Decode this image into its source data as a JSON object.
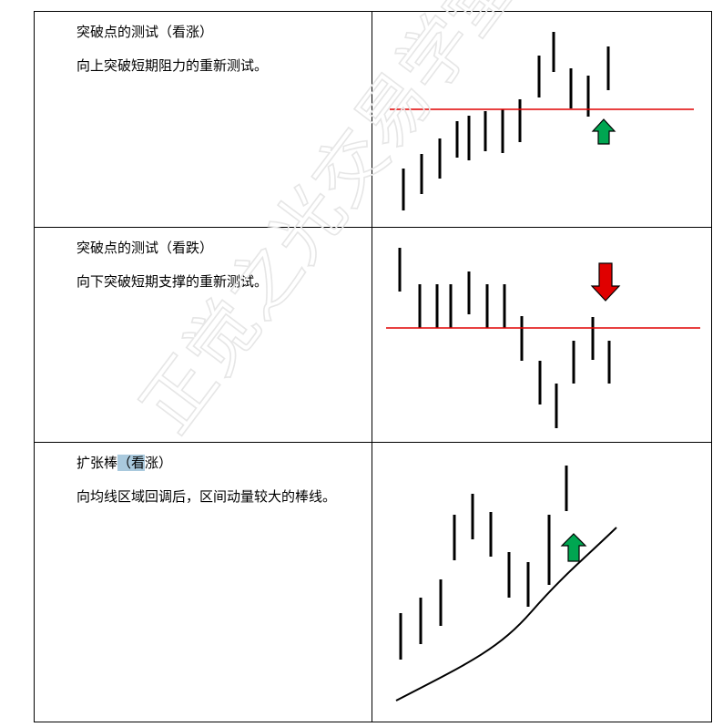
{
  "rows": [
    {
      "title": "突破点的测试（看涨）",
      "description": "向上突破短期阻力的重新测试。",
      "signal": "up",
      "colors": {
        "level_line": "#e00000",
        "arrow": "#00a651"
      }
    },
    {
      "title": "突破点的测试（看跌）",
      "description": "向下突破短期支撑的重新测试。",
      "signal": "down",
      "colors": {
        "level_line": "#e00000",
        "arrow": "#e00000"
      }
    },
    {
      "title_prefix": "扩张棒",
      "title_highlight": "（看",
      "title_suffix": "涨）",
      "description": "向均线区域回调后，区间动量较大的棒线。",
      "signal": "up",
      "colors": {
        "moving_average": "#000000",
        "arrow": "#00a651"
      }
    }
  ],
  "watermark": {
    "text": "正觉之光交易学堂"
  }
}
